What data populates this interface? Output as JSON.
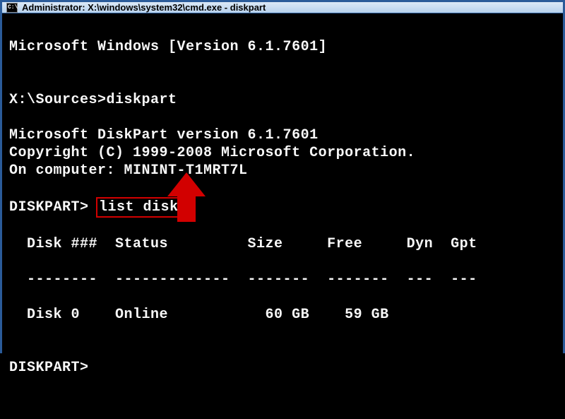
{
  "window": {
    "icon_text": "C:\\",
    "title": "Administrator: X:\\windows\\system32\\cmd.exe - diskpart"
  },
  "terminal": {
    "header_line": "Microsoft Windows [Version 6.1.7601]",
    "prompt1": "X:\\Sources>",
    "command1": "diskpart",
    "diskpart_version": "Microsoft DiskPart version 6.1.7601",
    "copyright": "Copyright (C) 1999-2008 Microsoft Corporation.",
    "on_computer": "On computer: MININT-T1MRT7L",
    "prompt2": "DISKPART>",
    "command2": "list disk",
    "table_header": "  Disk ###  Status         Size     Free     Dyn  Gpt",
    "table_divider": "  --------  -------------  -------  -------  ---  ---",
    "table_row0": "  Disk 0    Online           60 GB    59 GB",
    "prompt3": "DISKPART>"
  }
}
